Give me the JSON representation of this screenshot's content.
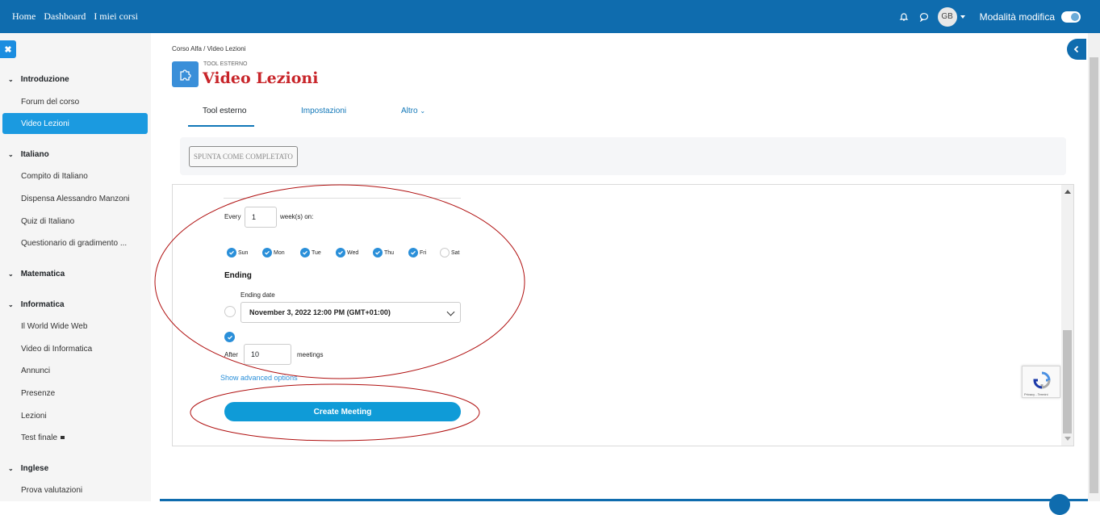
{
  "navbar": {
    "links": [
      "Home",
      "Dashboard",
      "I miei corsi"
    ],
    "avatar_initials": "GB",
    "edit_mode_label": "Modalità modifica",
    "icons": [
      "bell-icon",
      "chat-icon"
    ]
  },
  "sidebar": {
    "close_icon": "✖",
    "sections": [
      {
        "title": "Introduzione",
        "items": [
          "Forum del corso",
          "Video Lezioni"
        ]
      },
      {
        "title": "Italiano",
        "items": [
          "Compito di Italiano",
          "Dispensa Alessandro Manzoni",
          "Quiz di Italiano",
          "Questionario di gradimento ..."
        ]
      },
      {
        "title": "Matematica",
        "items": []
      },
      {
        "title": "Informatica",
        "items": [
          "Il World Wide Web",
          "Video di Informatica",
          "Annunci",
          "Presenze",
          "Lezioni",
          "Test finale"
        ]
      },
      {
        "title": "Inglese",
        "items": [
          "Prova valutazioni"
        ]
      }
    ],
    "active_item": "Video Lezioni"
  },
  "page": {
    "breadcrumb": "Corso Alfa   /   Video Lezioni",
    "subtitle": "TOOL ESTERNO",
    "title": "Video Lezioni",
    "tabs": [
      "Tool esterno",
      "Impostazioni",
      "Altro"
    ],
    "completion_button": "SPUNTA COME COMPLETATO"
  },
  "form": {
    "every_label": "Every",
    "every_value": "1",
    "weeks_label": "week(s) on:",
    "days": [
      {
        "label": "Sun",
        "checked": true
      },
      {
        "label": "Mon",
        "checked": true
      },
      {
        "label": "Tue",
        "checked": true
      },
      {
        "label": "Wed",
        "checked": true
      },
      {
        "label": "Thu",
        "checked": true
      },
      {
        "label": "Fri",
        "checked": true
      },
      {
        "label": "Sat",
        "checked": false
      }
    ],
    "ending_title": "Ending",
    "ending_date_label": "Ending date",
    "ending_date_value": "November 3, 2022 12:00 PM (GMT+01:00)",
    "after_label": "After",
    "after_value": "10",
    "meetings_label": "meetings",
    "advanced_link": "Show advanced options",
    "create_button": "Create Meeting"
  },
  "recaptcha": {
    "text": "Privacy - Termini"
  },
  "colors": {
    "navbar": "#0f6cae",
    "accent": "#1b9ae0",
    "title": "#c8252a",
    "annotation": "#b01010"
  }
}
